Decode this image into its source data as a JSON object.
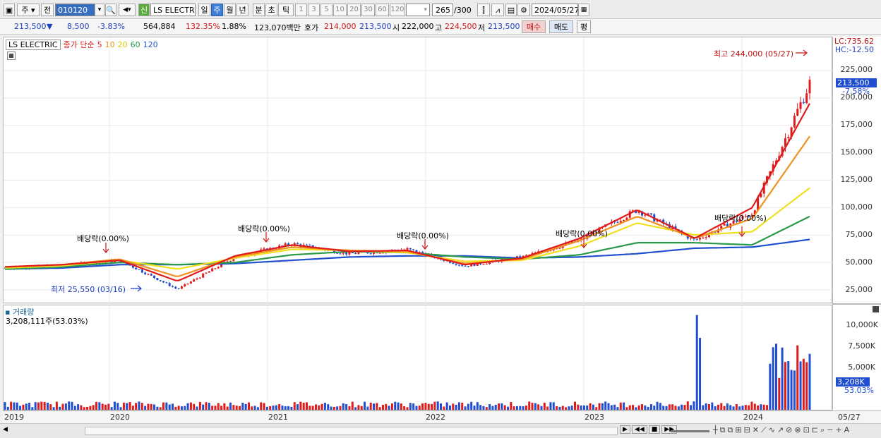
{
  "toolbar": {
    "market": "주",
    "prev": "전",
    "code": "010120",
    "name": "LS ELECTRI",
    "sin": "신",
    "periods": [
      "일",
      "주",
      "월",
      "년",
      "분",
      "초",
      "틱"
    ],
    "nums": [
      "1",
      "3",
      "5",
      "10",
      "20",
      "30",
      "60",
      "120"
    ],
    "count": "265",
    "count_total": "/300",
    "date": "2024/05/27"
  },
  "quote": {
    "price": "213,500",
    "change_arrow": "▼",
    "change": "8,500",
    "rate": "-3.83%",
    "volume": "564,884",
    "vol_ratio": "132.35%",
    "turnover": "1.88%",
    "amount": "123,070백만",
    "ask_label": "호가",
    "ask": "214,000",
    "bid": "213,500",
    "open_label": "시",
    "open": "222,000",
    "high_label": "고",
    "high": "224,500",
    "low_label": "저",
    "low": "213,500",
    "buy": "매수",
    "sell": "매도",
    "eval": "평"
  },
  "legend": {
    "name": "LS ELECTRIC",
    "ma_label": "종가 단순",
    "ma5": "5",
    "ma10": "10",
    "ma20": "20",
    "ma60": "60",
    "ma120": "120"
  },
  "annotations": {
    "high": "최고 244,000 (05/27)",
    "low": "최저 25,550 (03/16)",
    "div": "배당락(0.00%)"
  },
  "price_axis": {
    "lc": "LC:735.62",
    "hc": "HC:-12.50",
    "current": "213,500",
    "current_rate": "-7.58%",
    "ticks": [
      "225,000",
      "200,000",
      "175,000",
      "150,000",
      "125,000",
      "100,000",
      "75,000",
      "50,000",
      "25,000"
    ]
  },
  "volume_panel": {
    "title": "거래량",
    "value": "3,208,111주(53.03%)",
    "current": "3,208K",
    "current_rate": "53.03%",
    "ticks": [
      "10,000K",
      "7,500K",
      "5,000K"
    ]
  },
  "x_axis": {
    "labels": [
      "2019",
      "2020",
      "2021",
      "2022",
      "2023",
      "2024"
    ],
    "last": "05/27"
  },
  "colors": {
    "up": "#e01b1b",
    "down": "#1f4fd0",
    "ma5": "#e01b1b",
    "ma10": "#f0901e",
    "ma20": "#f0e020",
    "ma60": "#2a9a4a",
    "ma120": "#2050d0"
  },
  "chart_data": {
    "type": "candlestick",
    "x": [
      "2019-01",
      "2019-07",
      "2020-01",
      "2020-03",
      "2020-07",
      "2021-01",
      "2021-07",
      "2022-01",
      "2022-07",
      "2023-01",
      "2023-07",
      "2023-09",
      "2024-01",
      "2024-03",
      "2024-05"
    ],
    "close": [
      45000,
      47000,
      52000,
      25550,
      55000,
      67000,
      58000,
      62000,
      47000,
      55000,
      70000,
      98000,
      70000,
      95000,
      213500
    ],
    "series": [
      {
        "name": "5",
        "values": [
          46000,
          48000,
          52000,
          33000,
          56000,
          66000,
          60000,
          61000,
          48000,
          54000,
          72000,
          98000,
          72000,
          100000,
          195000
        ]
      },
      {
        "name": "10",
        "values": [
          46000,
          48000,
          53000,
          37000,
          55000,
          64000,
          61000,
          60000,
          49000,
          53000,
          70000,
          92000,
          72000,
          90000,
          165000
        ]
      },
      {
        "name": "20",
        "values": [
          45000,
          47000,
          52000,
          44000,
          54000,
          62000,
          61000,
          59000,
          51000,
          52000,
          65000,
          86000,
          75000,
          78000,
          118000
        ]
      },
      {
        "name": "60",
        "values": [
          44000,
          46000,
          50000,
          48000,
          50000,
          57000,
          60000,
          59000,
          55000,
          53000,
          57000,
          68000,
          68000,
          66000,
          92000
        ]
      },
      {
        "name": "120",
        "values": [
          44000,
          45000,
          48000,
          48000,
          49000,
          52000,
          55000,
          56000,
          56000,
          54000,
          55000,
          58000,
          63000,
          64000,
          71000
        ]
      }
    ],
    "ylim": [
      10000,
      244000
    ]
  }
}
